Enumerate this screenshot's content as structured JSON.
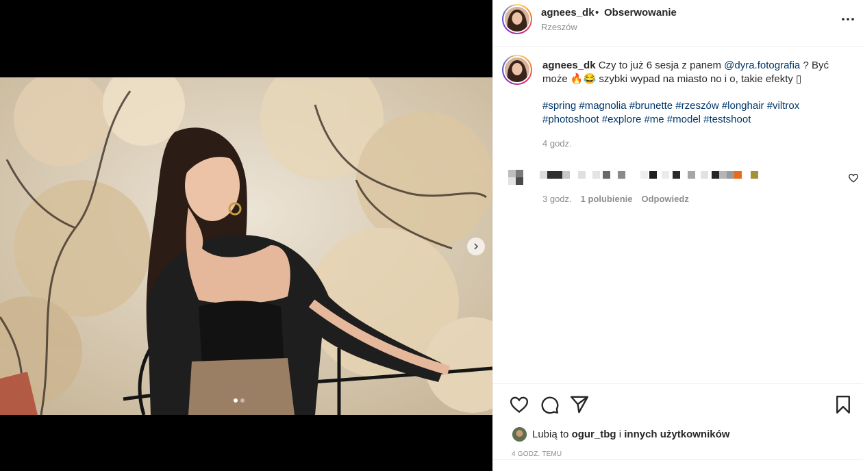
{
  "post": {
    "username": "agnees_dk",
    "separator": "•",
    "follow_status": "Obserwowanie",
    "location": "Rzeszów"
  },
  "caption": {
    "username": "agnees_dk",
    "text_1": "Czy to już 6 sesja z panem",
    "mention": "@dyra.fotografia",
    "text_2": "? Być może",
    "emoji": "🔥😂",
    "text_3": "szybki wypad na miasto no i o, takie efekty",
    "trailing_glyph": "▯",
    "hashtags": "#spring #magnolia #brunette #rzeszów #longhair #viltrox #photoshoot #explore #me #model #testshoot",
    "time": "4 godz."
  },
  "comment": {
    "time": "3 godz.",
    "likes": "1 polubienie",
    "reply": "Odpowiedz"
  },
  "likes": {
    "prefix": "Lubią to",
    "user": "ogur_tbg",
    "conj": "i",
    "others": "innych użytkowników"
  },
  "post_time": "4 GODZ. TEMU",
  "media": {
    "slides": 2,
    "active_slide": 1
  },
  "icons": {
    "more": "more-horizontal-icon",
    "next": "chevron-right-icon",
    "like": "heart-icon",
    "comment": "comment-icon",
    "share": "send-icon",
    "save": "bookmark-icon",
    "comment_like": "heart-icon"
  },
  "colors": {
    "link": "#00376b",
    "muted": "#8e8e8e",
    "text": "#262626",
    "border": "#efefef"
  }
}
